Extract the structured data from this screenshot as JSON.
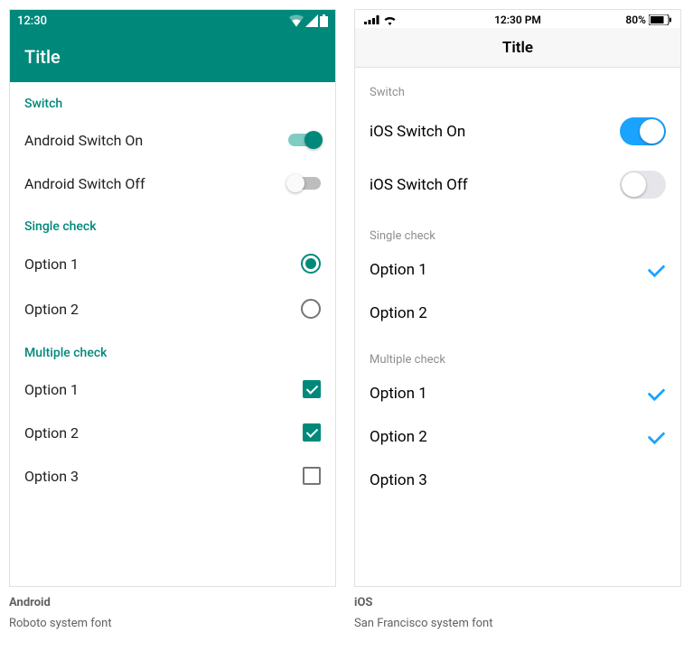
{
  "android": {
    "status": {
      "time": "12:30"
    },
    "title": "Title",
    "sections": {
      "switch": {
        "header": "Switch",
        "on_label": "Android Switch On",
        "off_label": "Android Switch Off"
      },
      "single": {
        "header": "Single check",
        "opt1": "Option 1",
        "opt2": "Option 2"
      },
      "multi": {
        "header": "Multiple check",
        "opt1": "Option 1",
        "opt2": "Option 2",
        "opt3": "Option 3"
      }
    },
    "caption": {
      "title": "Android",
      "sub": "Roboto system font"
    }
  },
  "ios": {
    "status": {
      "time": "12:30 PM",
      "battery": "80%"
    },
    "title": "Title",
    "sections": {
      "switch": {
        "header": "Switch",
        "on_label": "iOS Switch On",
        "off_label": "iOS Switch Off"
      },
      "single": {
        "header": "Single check",
        "opt1": "Option 1",
        "opt2": "Option 2"
      },
      "multi": {
        "header": "Multiple check",
        "opt1": "Option 1",
        "opt2": "Option 2",
        "opt3": "Option 3"
      }
    },
    "caption": {
      "title": "iOS",
      "sub": "San Francisco system font"
    }
  }
}
